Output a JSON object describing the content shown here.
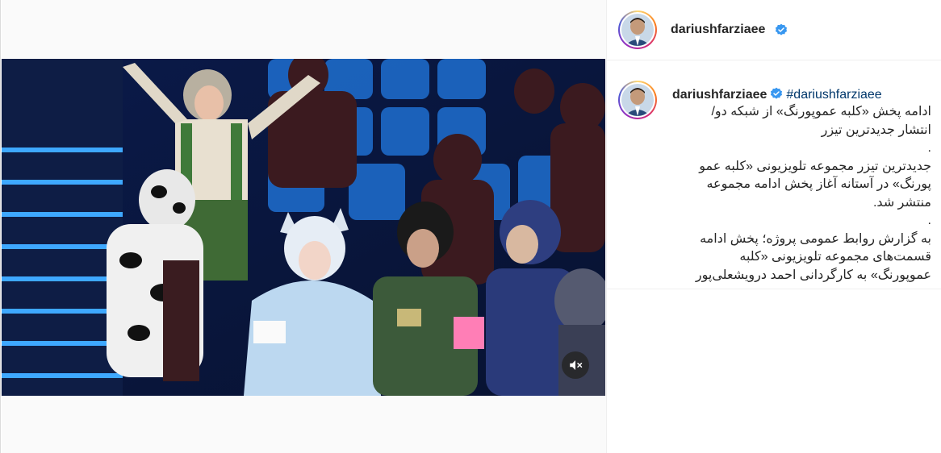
{
  "post": {
    "username": "dariushfarziaee",
    "verified": true,
    "hashtag": "#dariushfarziaee",
    "caption_lines": [
      "ادامه پخش «کلبه عموپورنگ» از شبکه دو/",
      "انتشار جدیدترین تیزر",
      ".",
      "جدیدترین تیزر مجموعه تلویزیونی «کلبه عمو",
      "پورنگ» در آستانه آغاز پخش ادامه مجموعه",
      "منتشر شد.",
      ".",
      "به گزارش روابط عمومی پروژه؛ پخش ادامه",
      "قسمت‌های مجموعه تلویزیونی «کلبه",
      "عموپورنگ» به کارگردانی احمد درویشعلی‌پور"
    ]
  },
  "media": {
    "type": "video",
    "muted": true,
    "mute_icon": "speaker-muted-icon"
  },
  "colors": {
    "verified_blue": "#3897f0",
    "hashtag": "#00376b",
    "text": "#262626",
    "border": "#dbdbdb"
  }
}
